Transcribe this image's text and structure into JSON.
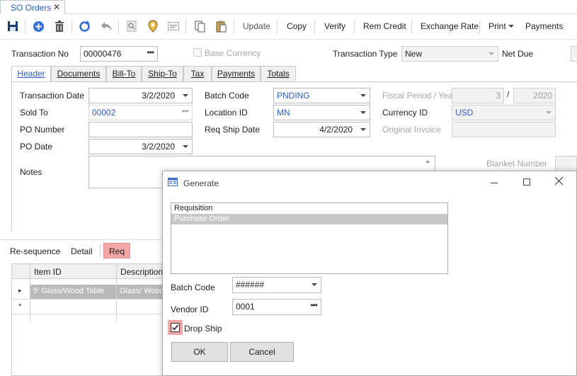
{
  "doc_tab": {
    "title": "SO Orders",
    "close": "✕"
  },
  "toolbar": {
    "update": "Update",
    "copy": "Copy",
    "verify": "Verify",
    "rem_credit": "Rem Credit",
    "exchange_rate": "Exchange Rate",
    "print": "Print",
    "payments": "Payments"
  },
  "top": {
    "transaction_no_label": "Transaction No",
    "transaction_no": "00000476",
    "base_currency_label": "Base Currency",
    "transaction_type_label": "Transaction Type",
    "transaction_type": "New",
    "net_due_label": "Net Due"
  },
  "tabs": {
    "header": "Header",
    "documents": "Documents",
    "bill_to": "Bill-To",
    "ship_to": "Ship-To",
    "tax": "Tax",
    "payments": "Payments",
    "totals": "Totals"
  },
  "header_form": {
    "transaction_date_label": "Transaction Date",
    "transaction_date": "3/2/2020",
    "sold_to_label": "Sold To",
    "sold_to": "00002",
    "po_number_label": "PO Number",
    "po_number": "",
    "po_date_label": "PO Date",
    "po_date": "3/2/2020",
    "notes_label": "Notes",
    "batch_code_label": "Batch Code",
    "batch_code": "PNDING",
    "location_id_label": "Location ID",
    "location_id": "MN",
    "req_ship_date_label": "Req Ship Date",
    "req_ship_date": "4/2/2020",
    "fiscal_label": "Fiscal Period / Year",
    "fiscal_period": "3",
    "fiscal_sep": "/",
    "fiscal_year": "2020",
    "currency_id_label": "Currency ID",
    "currency_id": "USD",
    "original_invoice_label": "Original Invoice",
    "blanket_number_label": "Blanket Number"
  },
  "sub_tabs": {
    "resequence": "Re-sequence",
    "detail": "Detail",
    "req": "Req"
  },
  "grid": {
    "columns": [
      "Item ID",
      "Description"
    ],
    "rows": [
      {
        "item_id": "5' Glass/Wood Table",
        "description": "Glass/ Wood"
      }
    ],
    "new_row_marker": "*",
    "current_row_marker": "▸"
  },
  "dialog": {
    "title": "Generate",
    "options": [
      "Requisition",
      "Purchase Order"
    ],
    "selected_index": 1,
    "batch_code_label": "Batch Code",
    "batch_code": "######",
    "vendor_id_label": "Vendor ID",
    "vendor_id": "0001",
    "drop_ship_label": "Drop Ship",
    "drop_ship_checked": true,
    "ok": "OK",
    "cancel": "Cancel"
  },
  "colors": {
    "accent_blue": "#2c5cc5",
    "highlight_red": "#f2a6a6",
    "selection_gray": "#c8c8c8"
  }
}
